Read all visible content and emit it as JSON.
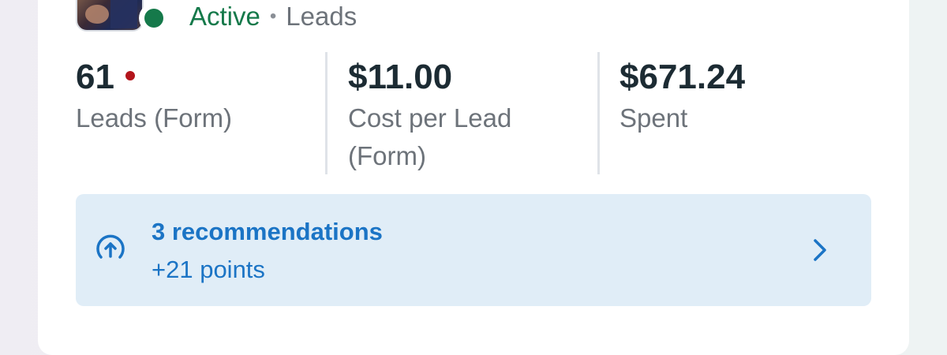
{
  "header": {
    "status": "Active",
    "separator": "•",
    "objective": "Leads"
  },
  "metrics": [
    {
      "value": "61",
      "label": "Leads (Form)",
      "has_alert_dot": true
    },
    {
      "value": "$11.00",
      "label": "Cost per Lead (Form)"
    },
    {
      "value": "$671.24",
      "label": "Spent"
    }
  ],
  "recommendations": {
    "title": "3 recommendations",
    "subtitle": "+21 points",
    "icon": "arrow-up-circle-icon",
    "chevron": "chevron-right-icon"
  },
  "colors": {
    "active_green": "#15794a",
    "alert_red": "#b3141b",
    "link_blue": "#1b74c5",
    "reco_bg": "#e0edf7",
    "text_dark": "#1c2b33",
    "text_muted": "#6d737a"
  }
}
